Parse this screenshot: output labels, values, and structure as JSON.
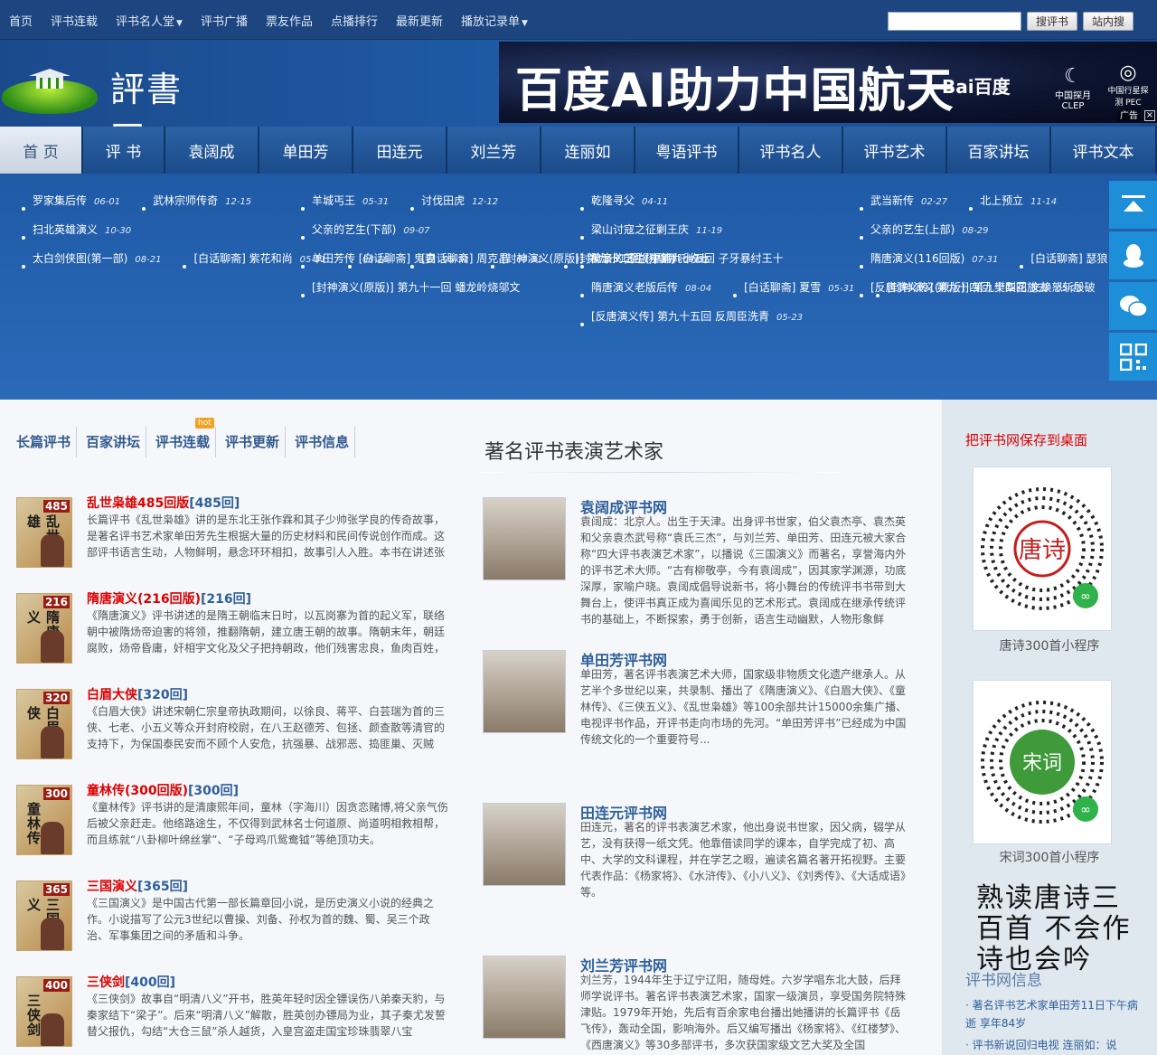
{
  "topnav": [
    "首页",
    "评书连载",
    "评书名人堂",
    "评书广播",
    "票友作品",
    "点播排行",
    "最新更新",
    "播放记录单"
  ],
  "search": {
    "placeholder": "",
    "btn1": "搜评书",
    "btn2": "站内搜"
  },
  "logo": {
    "name": "評書网"
  },
  "banner": {
    "text": "百度AI助力中国航天",
    "brand": "Bai百度",
    "partner1": "中国探月 CLEP",
    "partner2": "中国行星探测 PEC",
    "ad": "广告"
  },
  "mainnav": [
    "首 页",
    "评 书",
    "袁阔成",
    "单田芳",
    "田连元",
    "刘兰芳",
    "连丽如",
    "粤语评书",
    "评书名人",
    "评书艺术",
    "百家讲坛",
    "评书文本"
  ],
  "news": [
    [
      {
        "t": "罗家集后传",
        "d": "06-01"
      },
      {
        "t": "武林宗师传奇",
        "d": "12-15"
      },
      {
        "t": "扫北英雄演义",
        "d": "10-30"
      },
      {
        "t": "太白剑侠图(第一部)",
        "d": "08-21"
      },
      {
        "t": "[白话聊斋] 紫花和尚",
        "d": "05-31"
      },
      {
        "t": "[白话聊斋] 鬼妻",
        "d": "05-31"
      },
      {
        "t": "[封神演义(原版)] 第九十二回 杨戬哪吒收七",
        "d": ""
      }
    ],
    [
      {
        "t": "羊城丐王",
        "d": "05-31"
      },
      {
        "t": "讨伐田虎",
        "d": "12-12"
      },
      {
        "t": "父亲的艺生(下部)",
        "d": "09-07"
      },
      {
        "t": "单田芳传",
        "d": "08-16"
      },
      {
        "t": "[白话聊斋] 周克昌",
        "d": "05-31"
      },
      {
        "t": "[封神演义(原版)] 第九十五回 子牙暴纣王十",
        "d": ""
      },
      {
        "t": "[封神演义(原版)] 第九十一回 蟠龙岭烧邬文",
        "d": ""
      }
    ],
    [
      {
        "t": "乾隆寻父",
        "d": "04-11"
      },
      {
        "t": "梁山讨寇之征剿王庆",
        "d": "11-19"
      },
      {
        "t": "父亲的艺生(中部)",
        "d": "09-01"
      },
      {
        "t": "隋唐演义老版后传",
        "d": "08-04"
      },
      {
        "t": "[白话聊斋] 夏雪",
        "d": "05-31"
      },
      {
        "t": "[封神演义(原版)] 第九十四回 文焕怒斩殷破",
        "d": ""
      },
      {
        "t": "[反唐演义传] 第九十五回 反周臣洗青",
        "d": "05-23"
      }
    ],
    [
      {
        "t": "武当新传",
        "d": "02-27"
      },
      {
        "t": "北上预立",
        "d": "11-14"
      },
      {
        "t": "父亲的艺生(上部)",
        "d": "08-29"
      },
      {
        "t": "隋唐演义(116回版)",
        "d": "07-31"
      },
      {
        "t": "[白话聊斋] 瑟狼",
        "d": "05-31"
      },
      {
        "t": "[封神演义(原版)] 第九十三回 金吒智取游魂",
        "d": ""
      },
      {
        "t": "[反唐演义传] 第九十四回 樊梨花施去",
        "d": "05-23"
      }
    ]
  ],
  "tabs": [
    "长篇评书",
    "百家讲坛",
    "评书连载",
    "评书更新",
    "评书信息"
  ],
  "hot": "hot",
  "books": [
    {
      "title": "乱世枭雄485回版",
      "ep": "[485回]",
      "num": "485",
      "cover": "乱世枭雄",
      "desc": "长篇评书《乱世枭雄》讲的是东北王张作霖和其子少帅张学良的传奇故事，是著名评书艺术家单田芳先生根据大量的历史材料和民间传说创作而成。这部评书语言生动，人物鲜明，悬念环环相扣，故事引人入胜。本书在讲述张"
    },
    {
      "title": "隋唐演义(216回版)",
      "ep": "[216回]",
      "num": "216",
      "cover": "隋唐演义",
      "desc": "《隋唐演义》评书讲述的是隋王朝临末日时，以瓦岗寨为首的起义军，联络朝中被隋炀帝迫害的将领，推翻隋朝，建立唐王朝的故事。隋朝末年，朝廷腐败，炀帝昏庸，奸相宇文化及父子把持朝政，他们残害忠良，鱼肉百姓，"
    },
    {
      "title": "白眉大侠",
      "ep": "[320回]",
      "num": "320",
      "cover": "白眉大侠",
      "desc": "《白眉大侠》讲述宋朝仁宗皇帝执政期间，以徐良、蒋平、白芸瑞为首的三侠、七老、小五义等众开封府校尉，在八王赵德芳、包拯、颜查散等清官的支持下，为保国泰民安而不顾个人安危，抗强暴、战邪恶、捣匪巢、灭贼"
    },
    {
      "title": "童林传(300回版)",
      "ep": "[300回]",
      "num": "300",
      "cover": "童林传",
      "desc": "《童林传》评书讲的是清康熙年间，童林（字海川）因贪恋赌博,将父亲气伤后被父亲赶走。他络路途生，不仅得到武林名士何道原、尚道明相救相帮，而且练就“八卦柳叶绵丝掌”、“子母鸡爪鸳鸯钺”等绝顶功夫。"
    },
    {
      "title": "三国演义",
      "ep": "[365回]",
      "num": "365",
      "cover": "三国演义",
      "desc": "《三国演义》是中国古代第一部长篇章回小说，是历史演义小说的经典之作。小说描写了公元3世纪以曹操、刘备、孙权为首的魏、蜀、吴三个政治、军事集团之间的矛盾和斗争。"
    },
    {
      "title": "三侠剑",
      "ep": "[400回]",
      "num": "400",
      "cover": "三侠剑",
      "desc": "《三侠剑》故事自“明清八义”开书，胜英年轻时因全镖误伤八弟秦天豹，与秦家结下“梁子”。后来“明清八义”解散，胜英创办镖局为业，其子秦尤发誓替父报仇，勾结“大仓三鼠”杀人越货，入皇宫盗走国宝珍珠翡翠八宝"
    }
  ],
  "center": {
    "title": "著名评书表演艺术家",
    "artists": [
      {
        "title": "袁阔成评书网",
        "desc": "袁阔成：北京人。出生于天津。出身评书世家，伯父袁杰亭、袁杰英和父亲袁杰武号称“袁氏三杰”，与刘兰芳、单田芳、田连元被大家合称“四大评书表演艺术家”，以播说《三国演义》而著名，享誉海内外的评书艺术大师。“古有柳敬亭，今有袁阔成”，因其家学渊源，功底深厚，家喻户晓。袁阔成倡导说新书，将小舞台的传统评书书带到大舞台上，使评书真正成为喜闻乐见的艺术形式。袁阔成在继承传统评书的基础上，不断探索，勇于创新，语言生动幽默，人物形象鲜"
      },
      {
        "title": "单田芳评书网",
        "desc": "单田芳，著名评书表演艺术大师，国家级非物质文化遗产继承人。从艺半个多世纪以来，共录制、播出了《隋唐演义》、《白眉大侠》、《童林传》、《三侠五义》、《乱世枭雄》等100余部共计15000余集广播、电视评书作品，开评书走向市场的先河。“单田芳评书”已经成为中国传统文化的一个重要符号..."
      },
      {
        "title": "田连元评书网",
        "desc": "田连元，著名的评书表演艺术家，他出身说书世家，因父病，辍学从艺，没有获得一纸文凭。他靠借读同学的课本，自学完成了初、高中、大学的文科课程，并在学艺之暇，遍读名篇名著开拓视野。主要代表作品：《杨家将》、《水浒传》、《小八义》、《刘秀传》、《大话成语》等。"
      },
      {
        "title": "刘兰芳评书网",
        "desc": "刘兰芳，1944年生于辽宁辽阳，随母姓。六岁学唱东北大鼓，后拜师学说评书。著名评书表演艺术家，国家一级演员，享受国务院特殊津贴。1979年开始，先后有百余家电台播出她播讲的长篇评书《岳飞传》，轰动全国，影响海外。后又编写播出《杨家将》、《红楼梦》、《西唐演义》等30多部评书，多次获国家级文艺大奖及全国"
      }
    ]
  },
  "right": {
    "save": "把评书网保存到桌面",
    "qr1": "唐诗300首小程序",
    "qr1seal": "唐诗",
    "qr2": "宋词300首小程序",
    "qr2seal": "宋词",
    "calli": "熟读唐诗三百首 不会作诗也会吟",
    "infotitle": "评书网信息",
    "info1": "· 著名评书艺术家单田芳11日下午病逝 享年84岁",
    "info2": "· 评书新说回归电视 连丽如：说"
  },
  "colors": {
    "nav": "#1f5aa6",
    "accent_red": "#dd0000",
    "link": "#2e5f9a",
    "side_btn": "#1c8fd8"
  }
}
